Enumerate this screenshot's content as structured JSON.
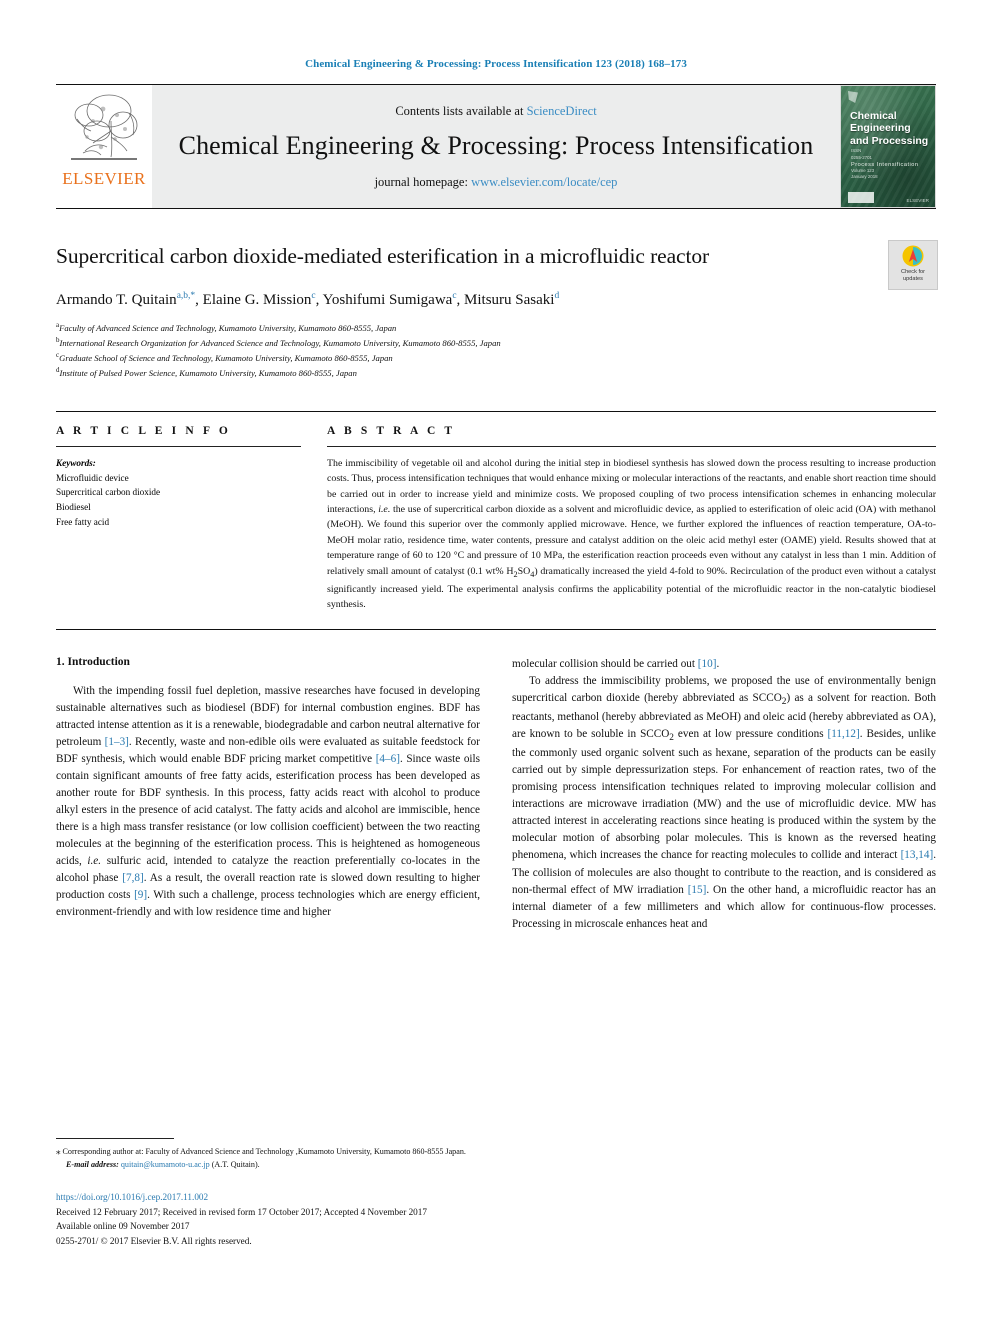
{
  "running_head": "Chemical Engineering & Processing: Process Intensification 123 (2018) 168–173",
  "masthead": {
    "contents_prefix": "Contents lists available at ",
    "sciencedirect": "ScienceDirect",
    "journal_title": "Chemical Engineering & Processing: Process Intensification",
    "homepage_prefix": "journal homepage: ",
    "homepage_url": "www.elsevier.com/locate/cep",
    "publisher": "ELSEVIER",
    "cover": {
      "title": "Chemical Engineering and Processing",
      "subtitle": "Process Intensification",
      "side_lines": "ISSN\n0255-2701\n\nVolume 123\nJanuary 2018",
      "imprint": "ELSEVIER"
    }
  },
  "article": {
    "title": "Supercritical carbon dioxide-mediated esterification in a microfluidic reactor",
    "authors_html": "Armando T. Quitain<sup class=\"aff\">a,b,</sup><sup class=\"star\">*</sup>, Elaine G. Mission<sup class=\"aff\">c</sup>, Yoshifumi Sumigawa<sup class=\"aff\">c</sup>, Mitsuru Sasaki<sup class=\"aff\">d</sup>",
    "affiliations": [
      {
        "marker": "a",
        "text": "Faculty of Advanced Science and Technology, Kumamoto University, Kumamoto 860-8555, Japan"
      },
      {
        "marker": "b",
        "text": "International Research Organization for Advanced Science and Technology, Kumamoto University, Kumamoto 860-8555, Japan"
      },
      {
        "marker": "c",
        "text": "Graduate School of Science and Technology, Kumamoto University, Kumamoto 860-8555, Japan"
      },
      {
        "marker": "d",
        "text": "Institute of Pulsed Power Science, Kumamoto University, Kumamoto 860-8555, Japan"
      }
    ],
    "crossmark_label": "Check for\nupdates"
  },
  "article_info": {
    "heading": "A R T I C L E   I N F O",
    "keywords_label": "Keywords:",
    "keywords": [
      "Microfluidic device",
      "Supercritical carbon dioxide",
      "Biodiesel",
      "Free fatty acid"
    ]
  },
  "abstract": {
    "heading": "A B S T R A C T",
    "text_html": "The immiscibility of vegetable oil and alcohol during the initial step in biodiesel synthesis has slowed down the process resulting to increase production costs. Thus, process intensification techniques that would enhance mixing or molecular interactions of the reactants, and enable short reaction time should be carried out in order to increase yield and minimize costs. We proposed coupling of two process intensification schemes in enhancing molecular interactions, <i>i.e.</i> the use of supercritical carbon dioxide as a solvent and microfluidic device, as applied to esterification of oleic acid (OA) with methanol (MeOH). We found this superior over the commonly applied microwave. Hence, we further explored the influences of reaction temperature, OA-to-MeOH molar ratio, residence time, water contents, pressure and catalyst addition on the oleic acid methyl ester (OAME) yield. Results showed that at temperature range of 60 to 120 °C and pressure of 10 MPa, the esterification reaction proceeds even without any catalyst in less than 1 min. Addition of relatively small amount of catalyst (0.1 wt% H<sub>2</sub>SO<sub>4</sub>) dramatically increased the yield 4-fold to 90%. Recirculation of the product even without a catalyst significantly increased yield. The experimental analysis confirms the applicability potential of the microfluidic reactor in the non-catalytic biodiesel synthesis."
  },
  "introduction": {
    "section_number_title": "1.  Introduction",
    "left_paragraphs_html": [
      "With the impending fossil fuel depletion, massive researches have focused in developing sustainable alternatives such as biodiesel (BDF) for internal combustion engines. BDF has attracted intense attention as it is a renewable, biodegradable and carbon neutral alternative for petroleum <span class=\"ref\">[1–3]</span>. Recently, waste and non-edible oils were evaluated as suitable feedstock for BDF synthesis, which would enable BDF pricing market competitive <span class=\"ref\">[4–6]</span>. Since waste oils contain significant amounts of free fatty acids, esterification process has been developed as another route for BDF synthesis. In this process, fatty acids react with alcohol to produce alkyl esters in the presence of acid catalyst. The fatty acids and alcohol are immiscible, hence there is a high mass transfer resistance (or low collision coefficient) between the two reacting molecules at the beginning of the esterification process. This is heightened as homogeneous acids, <i>i.e.</i> sulfuric acid, intended to catalyze the reaction preferentially co-locates in the alcohol phase <span class=\"ref\">[7,8]</span>. As a result, the overall reaction rate is slowed down resulting to higher production costs <span class=\"ref\">[9]</span>. With such a challenge, process technologies which are energy efficient, environment-friendly and with low residence time and higher"
    ],
    "right_paragraphs_html": [
      "molecular collision should be carried out <span class=\"ref\">[10]</span>.",
      "To address the immiscibility problems, we proposed the use of environmentally benign supercritical carbon dioxide (hereby abbreviated as SCCO<sub>2</sub>) as a solvent for reaction. Both reactants, methanol (hereby abbreviated as MeOH) and oleic acid (hereby abbreviated as OA), are known to be soluble in SCCO<sub>2</sub> even at low pressure conditions <span class=\"ref\">[11,12]</span>. Besides, unlike the commonly used organic solvent such as hexane, separation of the products can be easily carried out by simple depressurization steps. For enhancement of reaction rates, two of the promising process intensification techniques related to improving molecular collision and interactions are microwave irradiation (MW) and the use of microfluidic device. MW has attracted interest in accelerating reactions since heating is produced within the system by the molecular motion of absorbing polar molecules. This is known as the reversed heating phenomena, which increases the chance for reacting molecules to collide and interact <span class=\"ref\">[13,14]</span>. The collision of molecules are also thought to contribute to the reaction, and is considered as non-thermal effect of MW irradiation <span class=\"ref\">[15]</span>. On the other hand, a microfluidic reactor has an internal diameter of a few millimeters and which allow for continuous-flow processes. Processing in microscale enhances heat and"
    ]
  },
  "footnotes": {
    "corresponding_html": "<span style=\"font-size:9px\">⁎</span> Corresponding author at: Faculty of Advanced Science and Technology ,Kumamoto University, Kumamoto 860-8555 Japan.",
    "email_label": "E-mail address:",
    "email": "quitain@kumamoto-u.ac.jp",
    "email_suffix": "(A.T. Quitain)."
  },
  "publication": {
    "doi": "https://doi.org/10.1016/j.cep.2017.11.002",
    "dates": "Received 12 February 2017; Received in revised form 17 October 2017; Accepted 4 November 2017",
    "available": "Available online 09 November 2017",
    "copyright": "0255-2701/ © 2017 Elsevier B.V. All rights reserved."
  },
  "colors": {
    "link": "#2a7ab0",
    "elsevier_orange": "#e9711c",
    "masthead_grey": "#eceded",
    "cover_green": "#2f6b4f"
  }
}
